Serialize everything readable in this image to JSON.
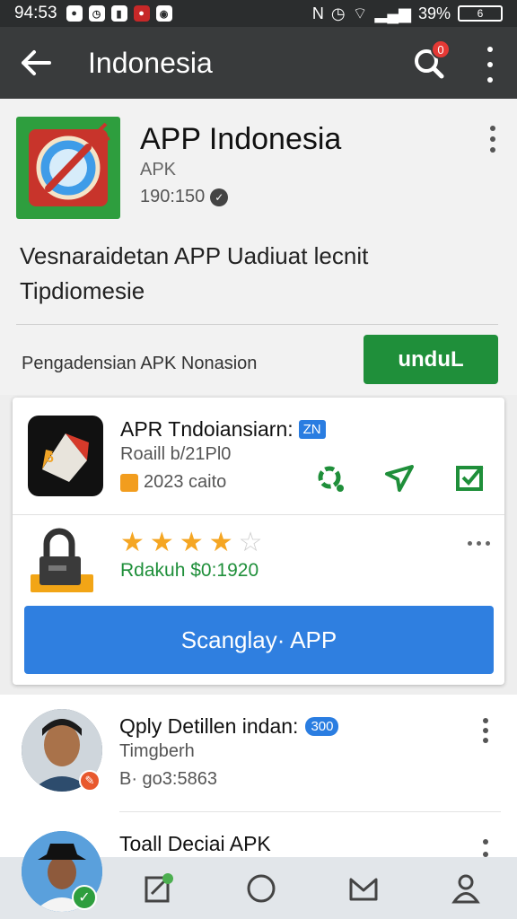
{
  "status_bar": {
    "time": "94:53",
    "battery": "39%",
    "battery_box": "6"
  },
  "app_bar": {
    "title": "Indonesia",
    "notification_count": "0"
  },
  "app": {
    "name": "APP Indonesia",
    "type": "APK",
    "size": "190:150",
    "description": "Vesnaraidetan APP Uadiuat lecnit Tipdiomesie",
    "download_label": "Pengadensian APK Nonasion",
    "download_button": "unduL"
  },
  "card": {
    "title": "APR Tndoiansiarn:",
    "tag": "ZN",
    "subtitle": "Roaill b/21Pl0",
    "date": "2023 caito",
    "rating": 4,
    "rating_max": 5,
    "price": "Rdakuh $0:1920",
    "scan_button": "Scanglay· APP"
  },
  "list": [
    {
      "name": "Qply Detillen indan:",
      "badge": "300",
      "line2": "Timgberh",
      "line3": "B· go3:5863"
    },
    {
      "name": "Toall Deciai APK"
    }
  ],
  "colors": {
    "appbar": "#393b3c",
    "download": "#1f8f3a",
    "scan": "#2f7fe0"
  }
}
